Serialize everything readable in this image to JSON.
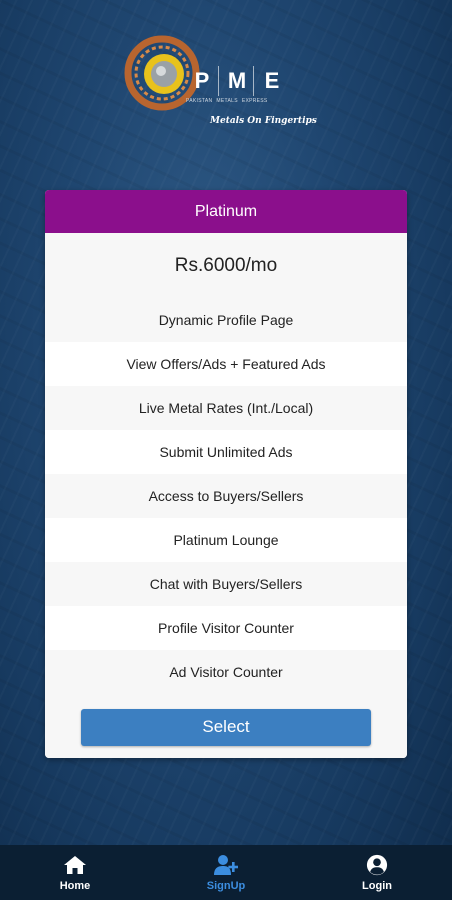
{
  "brand": {
    "letters": [
      "P",
      "M",
      "E"
    ],
    "sub": [
      "PAKISTAN",
      "METALS",
      "EXPRESS"
    ],
    "tagline": "Metals On Fingertips"
  },
  "plan": {
    "name": "Platinum",
    "price": "Rs.6000/mo",
    "features": [
      "Dynamic Profile Page",
      "View Offers/Ads + Featured Ads",
      "Live Metal Rates (Int./Local)",
      "Submit Unlimited Ads",
      "Access to Buyers/Sellers",
      "Platinum Lounge",
      "Chat with Buyers/Sellers",
      "Profile Visitor Counter",
      "Ad Visitor Counter"
    ],
    "select_label": "Select"
  },
  "nav": {
    "home": "Home",
    "signup": "SignUp",
    "login": "Login"
  },
  "colors": {
    "header": "#8b0f8c",
    "button": "#3c7fc1",
    "active_nav": "#3c8ee0"
  }
}
